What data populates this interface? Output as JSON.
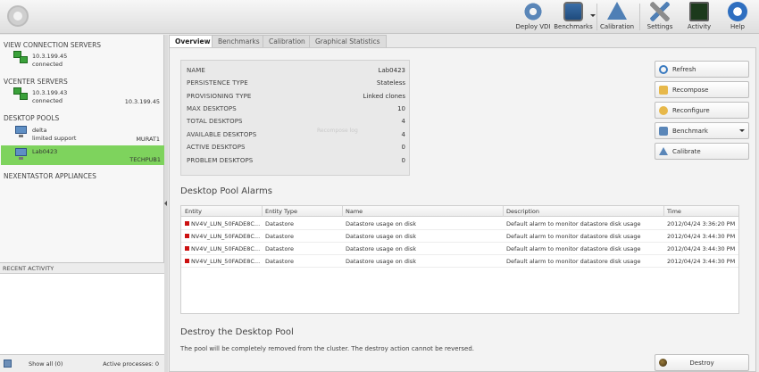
{
  "toolbar": {
    "items": [
      {
        "label": "Deploy VDI",
        "icon": "gear-wheels-icon"
      },
      {
        "label": "Benchmarks",
        "icon": "chart-monitor-icon"
      },
      {
        "label": "Calibration",
        "icon": "calibration-icon"
      },
      {
        "label": "Settings",
        "icon": "tools-icon"
      },
      {
        "label": "Activity",
        "icon": "activity-monitor-icon"
      },
      {
        "label": "Help",
        "icon": "help-icon"
      }
    ]
  },
  "sidebar": {
    "connection_servers_title": "VIEW CONNECTION SERVERS",
    "connection_server": {
      "ip": "10.3.199.45",
      "status": "connected"
    },
    "vcenter_title": "VCENTER SERVERS",
    "vcenter_server": {
      "ip": "10.3.199.43",
      "status": "connected",
      "right": "10.3.199.45"
    },
    "desktop_pools_title": "DESKTOP POOLS",
    "pools": [
      {
        "name": "delta",
        "sub": "limited support",
        "right": "MURAT1"
      },
      {
        "name": "Lab0423",
        "sub": "",
        "right": "TECHPUB1"
      }
    ],
    "appliances_title": "NEXENTASTOR APPLIANCES",
    "recent_title": "RECENT ACTIVITY",
    "show_all": "Show all (0)",
    "active_processes": "Active processes: 0"
  },
  "tabs": [
    {
      "label": "Overview"
    },
    {
      "label": "Benchmarks"
    },
    {
      "label": "Calibration"
    },
    {
      "label": "Graphical Statistics"
    }
  ],
  "overview": {
    "properties": [
      {
        "key": "NAME",
        "value": "Lab0423"
      },
      {
        "key": "PERSISTENCE TYPE",
        "value": "Stateless"
      },
      {
        "key": "PROVISIONING TYPE",
        "value": "Linked clones"
      },
      {
        "key": "MAX DESKTOPS",
        "value": "10"
      },
      {
        "key": "TOTAL DESKTOPS",
        "value": "4"
      },
      {
        "key": "AVAILABLE DESKTOPS",
        "value": "4"
      },
      {
        "key": "ACTIVE DESKTOPS",
        "value": "0"
      },
      {
        "key": "PROBLEM DESKTOPS",
        "value": "0"
      }
    ],
    "ghost_text": "Recompose log",
    "buttons": {
      "refresh": "Refresh",
      "recompose": "Recompose",
      "reconfigure": "Reconfigure",
      "benchmark": "Benchmark",
      "calibrate": "Calibrate"
    }
  },
  "alarms": {
    "title": "Desktop Pool Alarms",
    "columns": [
      "Entity",
      "Entity Type",
      "Name",
      "Description",
      "Time"
    ],
    "rows": [
      {
        "entity": "NV4V_LUN_50FADE8C...",
        "type": "Datastore",
        "name": "Datastore usage on disk",
        "description": "Default alarm to monitor datastore disk usage",
        "time": "2012/04/24 3:36:20 PM"
      },
      {
        "entity": "NV4V_LUN_50FADE8C...",
        "type": "Datastore",
        "name": "Datastore usage on disk",
        "description": "Default alarm to monitor datastore disk usage",
        "time": "2012/04/24 3:44:30 PM"
      },
      {
        "entity": "NV4V_LUN_50FADE8C...",
        "type": "Datastore",
        "name": "Datastore usage on disk",
        "description": "Default alarm to monitor datastore disk usage",
        "time": "2012/04/24 3:44:30 PM"
      },
      {
        "entity": "NV4V_LUN_50FADE8C...",
        "type": "Datastore",
        "name": "Datastore usage on disk",
        "description": "Default alarm to monitor datastore disk usage",
        "time": "2012/04/24 3:44:30 PM"
      }
    ]
  },
  "destroy": {
    "title": "Destroy the Desktop Pool",
    "description": "The pool will be completely removed from the cluster. The destroy action cannot be reversed.",
    "button": "Destroy"
  },
  "colors": {
    "selection": "#7ed35d",
    "alarm": "#cc1111"
  }
}
